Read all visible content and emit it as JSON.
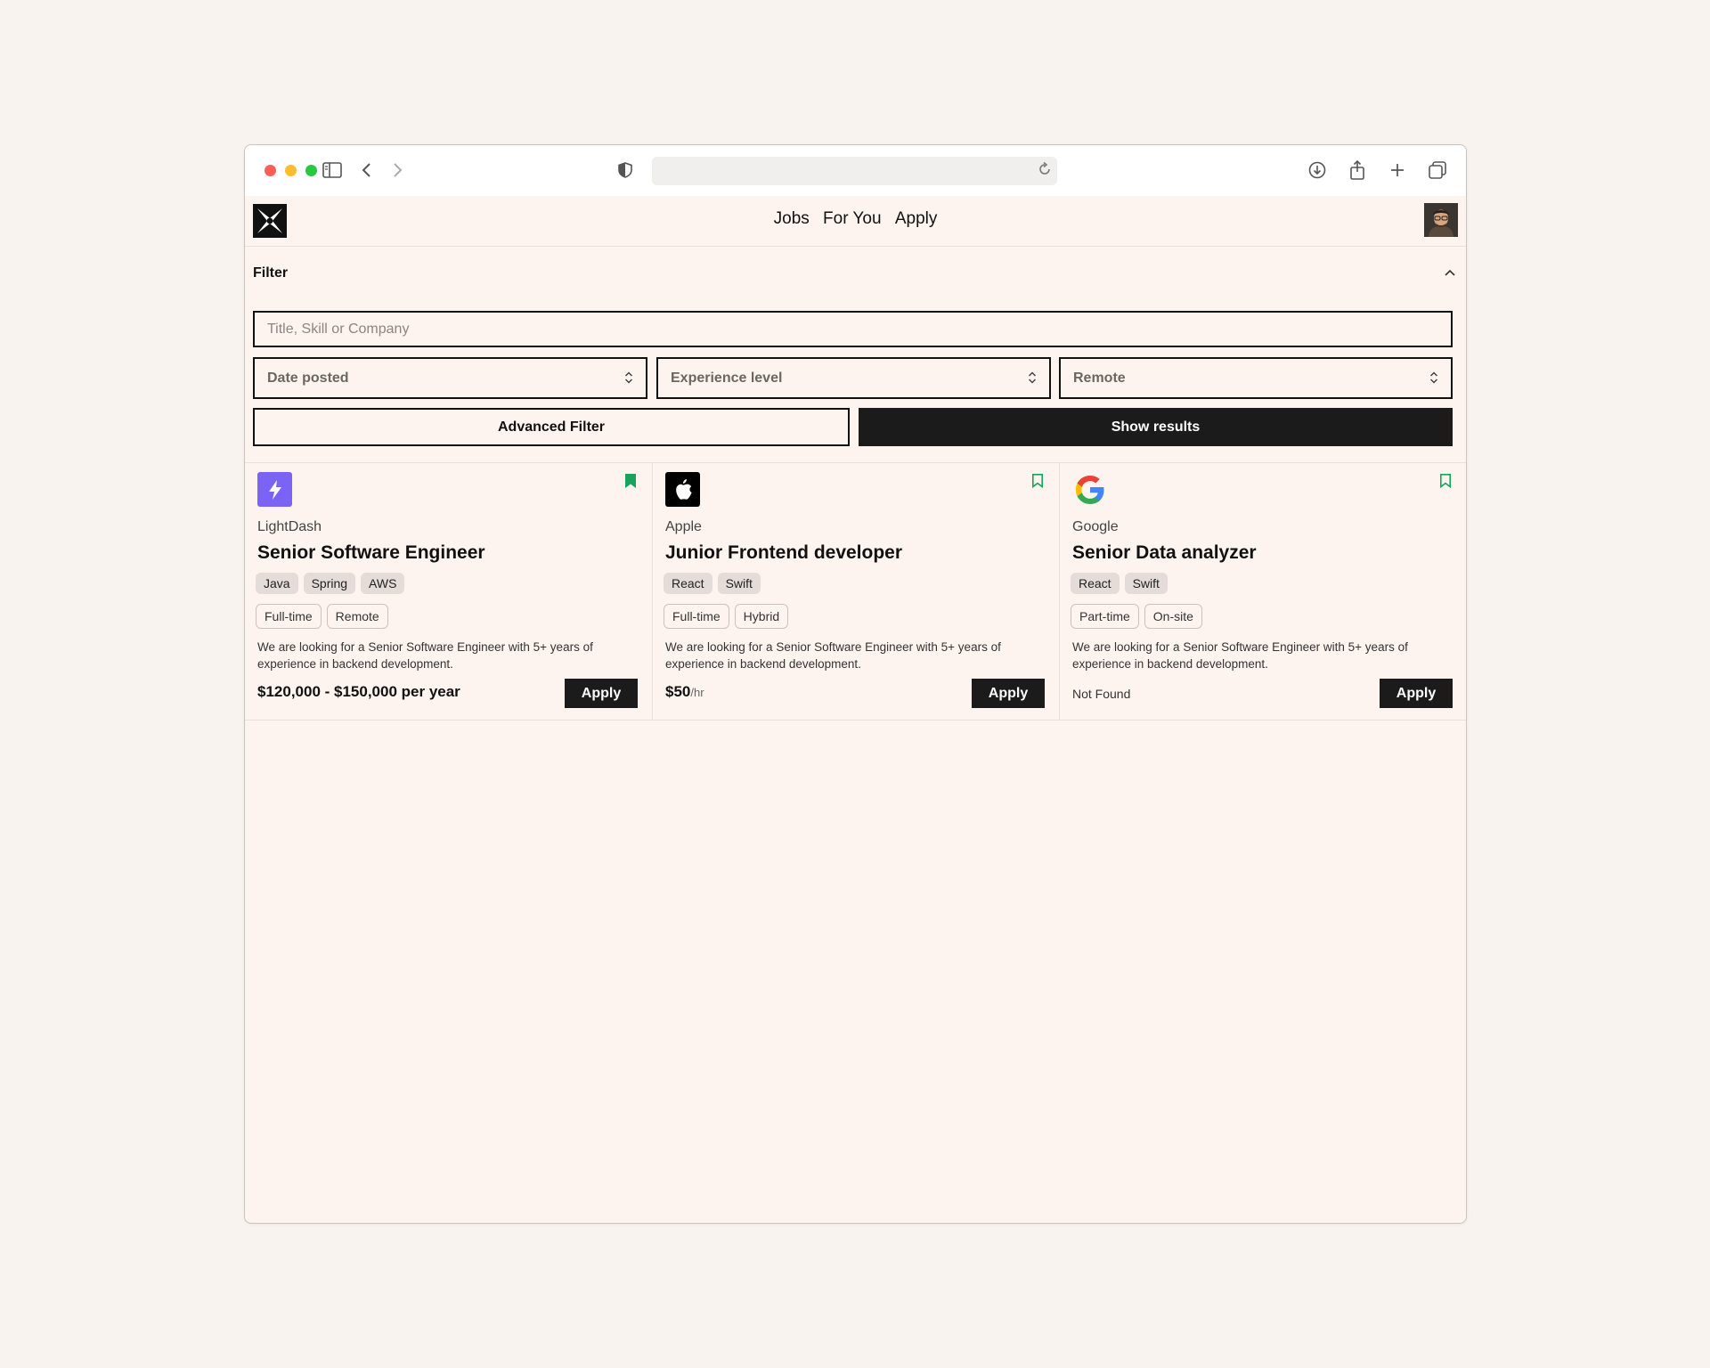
{
  "browser": {
    "url": ""
  },
  "nav": {
    "links": [
      "Jobs",
      "For You",
      "Apply"
    ]
  },
  "filter": {
    "title": "Filter",
    "search_placeholder": "Title, Skill or Company",
    "date_posted": "Date posted",
    "experience_level": "Experience level",
    "remote": "Remote",
    "advanced_label": "Advanced Filter",
    "show_label": "Show results"
  },
  "jobs": [
    {
      "company": "LightDash",
      "title": "Senior Software Engineer",
      "skills": [
        "Java",
        "Spring",
        "AWS"
      ],
      "types": [
        "Full-time",
        "Remote"
      ],
      "description": "We are looking for a Senior Software Engineer with 5+ years of experience in backend development.",
      "salary": "$120,000 - $150,000 per year",
      "salary_unit": "",
      "apply_label": "Apply",
      "bookmarked": true,
      "logo_icon": "lightning-bolt-icon"
    },
    {
      "company": "Apple",
      "title": "Junior Frontend developer",
      "skills": [
        "React",
        "Swift"
      ],
      "types": [
        "Full-time",
        "Hybrid"
      ],
      "description": "We are looking for a Senior Software Engineer with 5+ years of experience in backend development.",
      "salary": "$50",
      "salary_unit": "/hr",
      "apply_label": "Apply",
      "bookmarked": false,
      "logo_icon": "apple-icon"
    },
    {
      "company": "Google",
      "title": "Senior Data analyzer",
      "skills": [
        "React",
        "Swift"
      ],
      "types": [
        "Part-time",
        "On-site"
      ],
      "description": "We are looking for a Senior Software Engineer with 5+ years of experience in backend development.",
      "salary": "Not Found",
      "salary_unit": "",
      "apply_label": "Apply",
      "bookmarked": false,
      "logo_icon": "google-icon"
    }
  ],
  "colors": {
    "page_bg": "#fdf4f0",
    "accent_dark": "#1b1b1b",
    "bookmark_green": "#1aa35a",
    "lightdash_purple": "#7b63f5"
  }
}
